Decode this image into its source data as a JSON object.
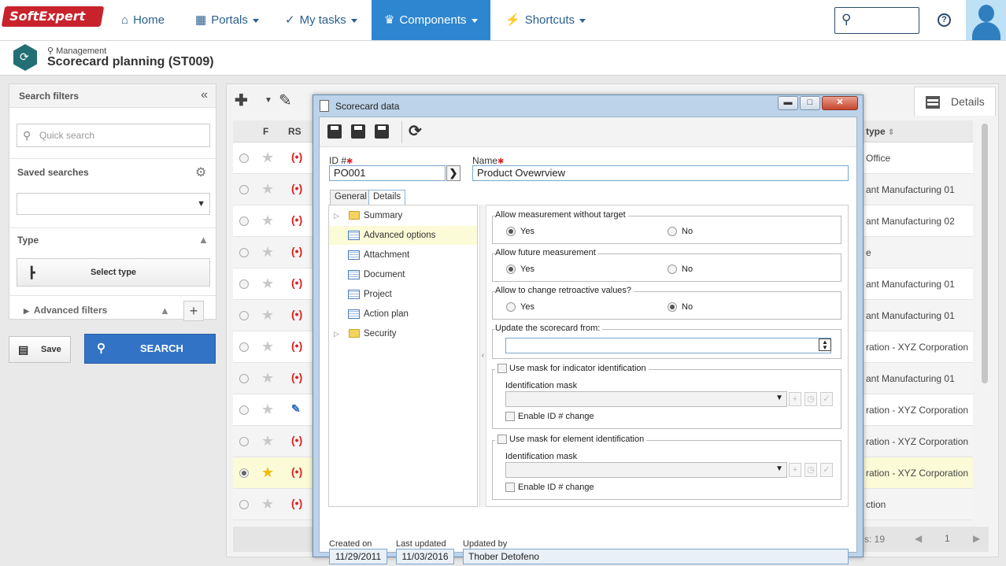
{
  "brand": {
    "logo_text": "SoftExpert"
  },
  "nav": {
    "home": "Home",
    "portals": "Portals",
    "my_tasks": "My tasks",
    "components": "Components",
    "shortcuts": "Shortcuts"
  },
  "header": {
    "breadcrumb": "Management",
    "title": "Scorecard planning (ST009)"
  },
  "filters": {
    "title": "Search filters",
    "quick_search_placeholder": "Quick search",
    "saved_searches": "Saved searches",
    "type_label": "Type",
    "select_type": "Select type",
    "advanced_filters": "Advanced filters",
    "save": "Save",
    "search": "SEARCH"
  },
  "grid": {
    "col_f": "F",
    "col_rs": "RS",
    "col_type": "type",
    "details_tab": "Details",
    "rows": [
      {
        "type": "Office",
        "selected": false,
        "starred": false,
        "status": "red"
      },
      {
        "type": "ant Manufacturing 01",
        "selected": false,
        "starred": false,
        "status": "red"
      },
      {
        "type": "ant Manufacturing 02",
        "selected": false,
        "starred": false,
        "status": "red"
      },
      {
        "type": "e",
        "selected": false,
        "starred": false,
        "status": "red"
      },
      {
        "type": "ant Manufacturing 01",
        "selected": false,
        "starred": false,
        "status": "red"
      },
      {
        "type": "ant Manufacturing 01",
        "selected": false,
        "starred": false,
        "status": "red"
      },
      {
        "type": "ration - XYZ Corporation",
        "selected": false,
        "starred": false,
        "status": "red"
      },
      {
        "type": "ant Manufacturing 01",
        "selected": false,
        "starred": false,
        "status": "red"
      },
      {
        "type": "ration - XYZ Corporation",
        "selected": false,
        "starred": false,
        "status": "edit"
      },
      {
        "type": "ration - XYZ Corporation",
        "selected": false,
        "starred": false,
        "status": "red"
      },
      {
        "type": "ration - XYZ Corporation",
        "selected": true,
        "starred": true,
        "status": "red"
      },
      {
        "type": "ction",
        "selected": false,
        "starred": false,
        "status": "red"
      }
    ],
    "count": "s: 19",
    "page": "1"
  },
  "modal": {
    "title": "Scorecard data",
    "id_label": "ID #",
    "id_value": "PO001",
    "name_label": "Name",
    "name_value": "Product Ovewrview",
    "tabs": {
      "general": "General",
      "details": "Details"
    },
    "tree": [
      {
        "label": "Summary",
        "kind": "folder",
        "expandable": true
      },
      {
        "label": "Advanced options",
        "kind": "form",
        "expandable": false,
        "selected": true
      },
      {
        "label": "Attachment",
        "kind": "form",
        "expandable": false
      },
      {
        "label": "Document",
        "kind": "form",
        "expandable": false
      },
      {
        "label": "Project",
        "kind": "form",
        "expandable": false
      },
      {
        "label": "Action plan",
        "kind": "form",
        "expandable": false
      },
      {
        "label": "Security",
        "kind": "folder",
        "expandable": true
      }
    ],
    "groups": {
      "g1": {
        "title": "Allow measurement without target",
        "yes": "Yes",
        "no": "No",
        "value": "yes"
      },
      "g2": {
        "title": "Allow future measurement",
        "yes": "Yes",
        "no": "No",
        "value": "yes"
      },
      "g3": {
        "title": "Allow to change retroactive values?",
        "yes": "Yes",
        "no": "No",
        "value": "no"
      },
      "g4": {
        "title": "Update the scorecard from:",
        "value": ""
      },
      "g5": {
        "title": "Use mask for indicator identification",
        "mask_label": "Identification mask",
        "enable_label": "Enable ID # change"
      },
      "g6": {
        "title": "Use mask for element identification",
        "mask_label": "Identification mask",
        "enable_label": "Enable ID # change"
      }
    },
    "footer": {
      "created_label": "Created on",
      "created_value": "11/29/2011",
      "updated_label": "Last updated",
      "updated_value": "11/03/2016",
      "by_label": "Updated by",
      "by_value": "Thober Detofeno"
    }
  }
}
